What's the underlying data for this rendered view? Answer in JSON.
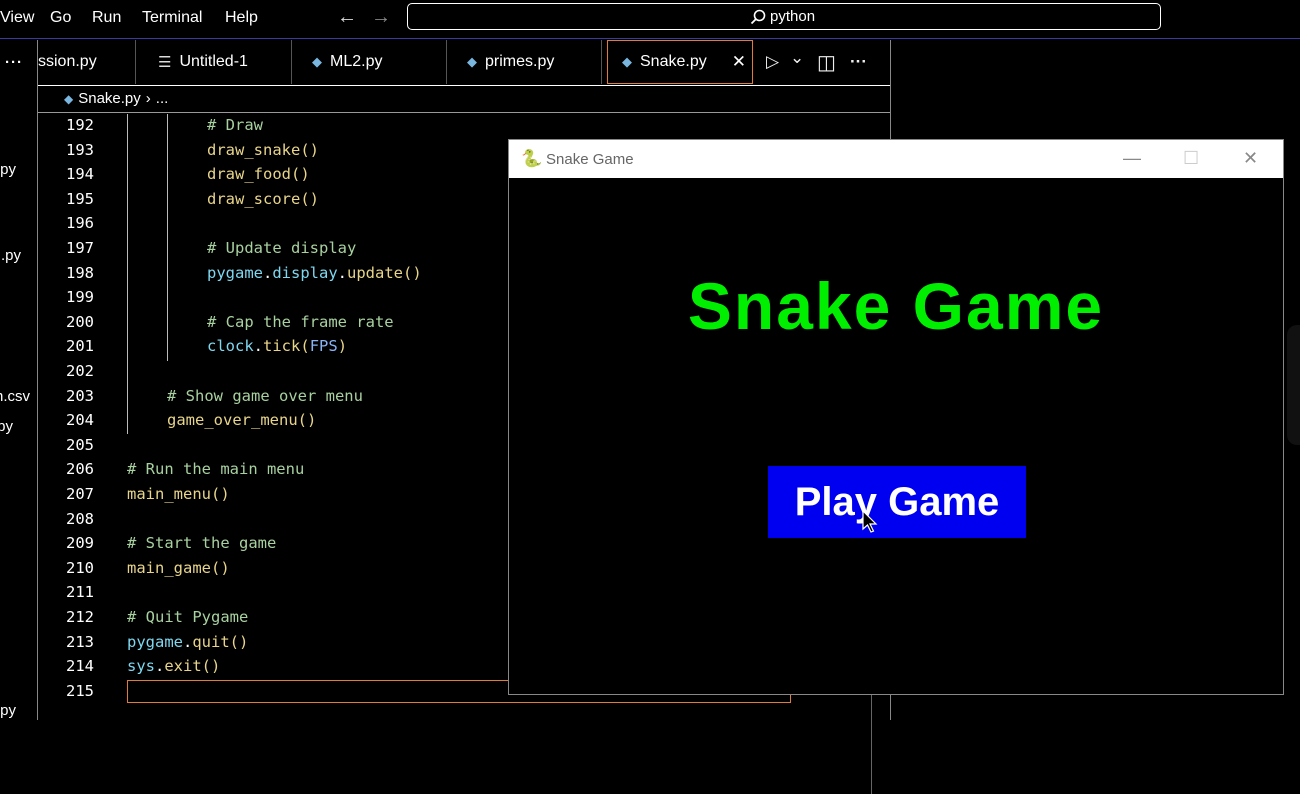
{
  "menubar": {
    "items": [
      "View",
      "Go",
      "Run",
      "Terminal",
      "Help"
    ],
    "back_arrow": "←",
    "forward_arrow": "→",
    "search_text": "python",
    "search_icon": "search-icon"
  },
  "explorer": {
    "items": [
      ".py",
      ".py",
      "n.csv",
      "py",
      "py"
    ],
    "more": "···"
  },
  "tabs": [
    {
      "label": "ssion.py",
      "icon": "python-file-icon"
    },
    {
      "label": "Untitled-1",
      "icon": "text-file-icon"
    },
    {
      "label": "ML2.py",
      "icon": "python-file-icon"
    },
    {
      "label": "primes.py",
      "icon": "python-file-icon"
    },
    {
      "label": "Snake.py",
      "icon": "python-file-icon",
      "active": true,
      "close": "✕"
    }
  ],
  "tab_actions": {
    "run": "▷",
    "run_dropdown": "⌄",
    "split": "◫",
    "more": "···"
  },
  "breadcrumb": {
    "file": "Snake.py",
    "sep": "›",
    "rest": "..."
  },
  "code_lines": [
    {
      "num": "192",
      "parts": [
        {
          "t": "# Draw",
          "c": "cmt"
        }
      ]
    },
    {
      "num": "193",
      "parts": [
        {
          "t": "draw_snake",
          "c": "fn"
        },
        {
          "t": "()",
          "c": "fn"
        }
      ]
    },
    {
      "num": "194",
      "parts": [
        {
          "t": "draw_food",
          "c": "fn"
        },
        {
          "t": "()",
          "c": "fn"
        }
      ]
    },
    {
      "num": "195",
      "parts": [
        {
          "t": "draw_score",
          "c": "fn"
        },
        {
          "t": "()",
          "c": "fn"
        }
      ]
    },
    {
      "num": "196",
      "parts": []
    },
    {
      "num": "197",
      "parts": [
        {
          "t": "# Update display",
          "c": "cmt"
        }
      ]
    },
    {
      "num": "198",
      "parts": [
        {
          "t": "pygame",
          "c": "var"
        },
        {
          "t": ".",
          "c": "plain"
        },
        {
          "t": "display",
          "c": "var"
        },
        {
          "t": ".",
          "c": "plain"
        },
        {
          "t": "update",
          "c": "fn"
        },
        {
          "t": "()",
          "c": "fn"
        }
      ]
    },
    {
      "num": "199",
      "parts": []
    },
    {
      "num": "200",
      "parts": [
        {
          "t": "# Cap the frame rate",
          "c": "cmt"
        }
      ]
    },
    {
      "num": "201",
      "parts": [
        {
          "t": "clock",
          "c": "var"
        },
        {
          "t": ".",
          "c": "plain"
        },
        {
          "t": "tick",
          "c": "fn"
        },
        {
          "t": "(",
          "c": "fn"
        },
        {
          "t": "FPS",
          "c": "const"
        },
        {
          "t": ")",
          "c": "fn"
        }
      ]
    },
    {
      "num": "202",
      "parts": []
    },
    {
      "num": "203",
      "parts": [
        {
          "t": "# Show game over menu",
          "c": "cmt"
        }
      ]
    },
    {
      "num": "204",
      "parts": [
        {
          "t": "game_over_menu",
          "c": "fn"
        },
        {
          "t": "()",
          "c": "fn"
        }
      ]
    },
    {
      "num": "205",
      "parts": []
    },
    {
      "num": "206",
      "parts": [
        {
          "t": "# Run the main menu",
          "c": "cmt"
        }
      ]
    },
    {
      "num": "207",
      "parts": [
        {
          "t": "main_menu",
          "c": "fn"
        },
        {
          "t": "()",
          "c": "fn"
        }
      ]
    },
    {
      "num": "208",
      "parts": []
    },
    {
      "num": "209",
      "parts": [
        {
          "t": "# Start the game",
          "c": "cmt"
        }
      ]
    },
    {
      "num": "210",
      "parts": [
        {
          "t": "main_game",
          "c": "fn"
        },
        {
          "t": "()",
          "c": "fn"
        }
      ]
    },
    {
      "num": "211",
      "parts": []
    },
    {
      "num": "212",
      "parts": [
        {
          "t": "# Quit Pygame",
          "c": "cmt"
        }
      ]
    },
    {
      "num": "213",
      "parts": [
        {
          "t": "pygame",
          "c": "var"
        },
        {
          "t": ".",
          "c": "plain"
        },
        {
          "t": "quit",
          "c": "fn"
        },
        {
          "t": "()",
          "c": "fn"
        }
      ]
    },
    {
      "num": "214",
      "parts": [
        {
          "t": "sys",
          "c": "var"
        },
        {
          "t": ".",
          "c": "plain"
        },
        {
          "t": "exit",
          "c": "fn"
        },
        {
          "t": "()",
          "c": "fn"
        }
      ]
    },
    {
      "num": "215",
      "parts": []
    }
  ],
  "game_window": {
    "title": "Snake Game",
    "minimize": "—",
    "maximize": "☐",
    "close": "✕",
    "heading": "Snake Game",
    "play_button": "Play Game",
    "heading_color": "#00ee00",
    "button_color": "#0000f0"
  }
}
